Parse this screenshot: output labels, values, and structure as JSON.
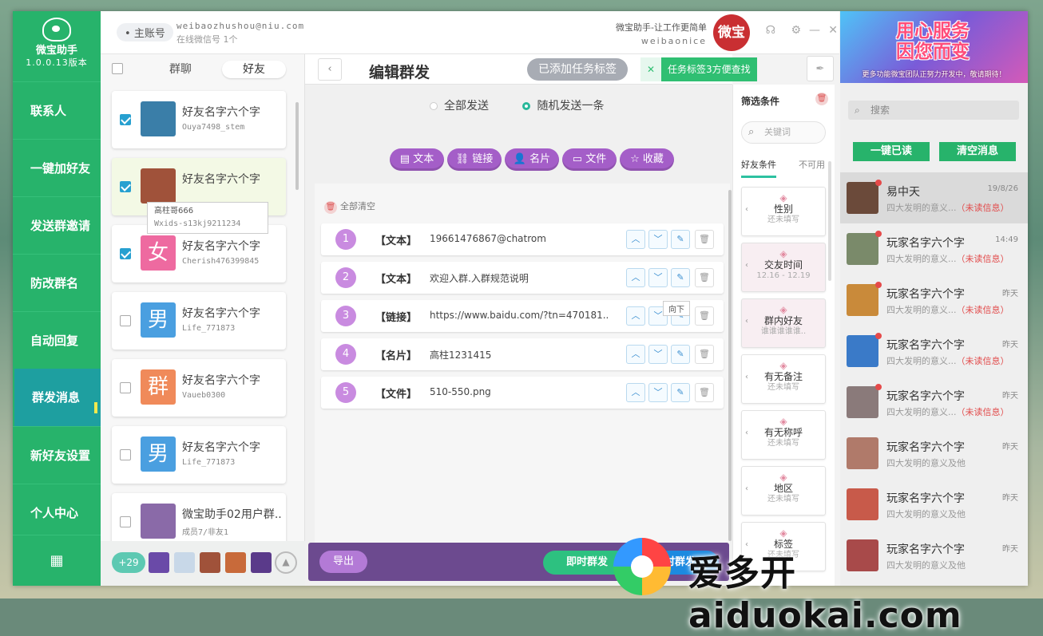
{
  "app": {
    "name": "微宝助手",
    "version": "1.0.0.13版本"
  },
  "nav": {
    "items": [
      "联系人",
      "一键加好友",
      "发送群邀请",
      "防改群名",
      "自动回复",
      "群发消息",
      "新好友设置",
      "个人中心"
    ],
    "active": "群发消息",
    "grid_icon": "grid-icon"
  },
  "topbar": {
    "account_label": "主账号",
    "email": "weibaozhushou@niu.com",
    "online": "在线微信号  1个",
    "slogan": "微宝助手-让工作更简单",
    "slogan_sub": "weibaonice",
    "badge": "微宝"
  },
  "friends": {
    "tabs": [
      "群聊",
      "好友"
    ],
    "active_tab": "好友",
    "items": [
      {
        "name": "好友名字六个字",
        "id": "Ouya7498_stem",
        "checked": true,
        "avatar": "photo",
        "color": "#3a7ea8"
      },
      {
        "name": "好友名字六个字",
        "id": "",
        "checked": true,
        "avatar": "photo",
        "color": "#a0523a"
      },
      {
        "name": "好友名字六个字",
        "id": "Cherish476399845",
        "checked": true,
        "avatar": "女",
        "color": "#ee6aa0"
      },
      {
        "name": "好友名字六个字",
        "id": "Life_771873",
        "checked": false,
        "avatar": "男",
        "color": "#4a9fe0"
      },
      {
        "name": "好友名字六个字",
        "id": "Vaueb0300",
        "checked": false,
        "avatar": "群",
        "color": "#f08a5a"
      },
      {
        "name": "好友名字六个字",
        "id": "Life_771873",
        "checked": false,
        "avatar": "男",
        "color": "#4a9fe0"
      },
      {
        "name": "微宝助手02用户群..",
        "id": "成员7/非友1",
        "checked": false,
        "avatar": "group",
        "color": "#8a6aa8"
      }
    ],
    "tooltip": {
      "name": "高柱哥666",
      "wxid": "Wxids-s13kj9211234"
    },
    "footer": {
      "more_count": "+29"
    }
  },
  "editor": {
    "title": "编辑群发",
    "tag_button": "已添加任务标签",
    "tag_tip": "任务标签3方便查找",
    "tag_close": "✕",
    "send_modes": [
      "全部发送",
      "随机发送一条"
    ],
    "send_mode_selected": "随机发送一条",
    "types": [
      "文本",
      "链接",
      "名片",
      "文件",
      "收藏"
    ],
    "clear_all": "全部清空",
    "messages": [
      {
        "n": "1",
        "type": "【文本】",
        "content": "19661476867@chatrom"
      },
      {
        "n": "2",
        "type": "【文本】",
        "content": "欢迎入群.入群规范说明"
      },
      {
        "n": "3",
        "type": "【链接】",
        "content": "https://www.baidu.com/?tn=470181.."
      },
      {
        "n": "4",
        "type": "【名片】",
        "content": "高柱1231415"
      },
      {
        "n": "5",
        "type": "【文件】",
        "content": "510-550.png"
      }
    ],
    "down_tip": "向下",
    "export": "导出",
    "send_now": "即时群发",
    "send_timed": "定时群发"
  },
  "filter": {
    "title": "筛选条件",
    "keyword_placeholder": "关键词",
    "tabs": [
      "好友条件",
      "不可用"
    ],
    "conditions": [
      {
        "name": "性别",
        "sub": "还未填写",
        "pink": false
      },
      {
        "name": "交友时间",
        "sub": "12.16 - 12.19",
        "pink": true
      },
      {
        "name": "群内好友",
        "sub": "谁谁谁谁谁..",
        "pink": true
      },
      {
        "name": "有无备注",
        "sub": "还未填写",
        "pink": false
      },
      {
        "name": "有无称呼",
        "sub": "还未填写",
        "pink": false
      },
      {
        "name": "地区",
        "sub": "还未填写",
        "pink": false
      },
      {
        "name": "标签",
        "sub": "还未填写",
        "pink": false
      }
    ]
  },
  "chat": {
    "banner_line1": "用心服务",
    "banner_line2": "因您而变",
    "banner_note": "更多功能微宝团队正努力开发中，敬请期待！",
    "search_placeholder": "搜索",
    "read_all": "一键已读",
    "clear_msgs": "清空消息",
    "items": [
      {
        "name": "易中天",
        "time": "19/8/26",
        "preview": "四大发明的意义...",
        "unread": "（未读信息）",
        "dot": true,
        "color": "#6b4a3a"
      },
      {
        "name": "玩家名字六个字",
        "time": "14:49",
        "preview": "四大发明的意义...",
        "unread": "（未读信息）",
        "dot": true,
        "color": "#7a8a6a"
      },
      {
        "name": "玩家名字六个字",
        "time": "昨天",
        "preview": "四大发明的意义...",
        "unread": "（未读信息）",
        "dot": true,
        "color": "#c98a3a"
      },
      {
        "name": "玩家名字六个字",
        "time": "昨天",
        "preview": "四大发明的意义...",
        "unread": "（未读信息）",
        "dot": true,
        "color": "#3a7ac8"
      },
      {
        "name": "玩家名字六个字",
        "time": "昨天",
        "preview": "四大发明的意义...",
        "unread": "（未读信息）",
        "dot": true,
        "color": "#8a7a7a"
      },
      {
        "name": "玩家名字六个字",
        "time": "昨天",
        "preview": "四大发明的意义及他",
        "unread": "",
        "dot": false,
        "color": "#b07a6a"
      },
      {
        "name": "玩家名字六个字",
        "time": "昨天",
        "preview": "四大发明的意义及他",
        "unread": "",
        "dot": false,
        "color": "#c85a4a"
      },
      {
        "name": "玩家名字六个字",
        "time": "昨天",
        "preview": "四大发明的意义及他",
        "unread": "",
        "dot": false,
        "color": "#a84a4a"
      }
    ]
  },
  "watermark": "爱多开aiduokai.com"
}
